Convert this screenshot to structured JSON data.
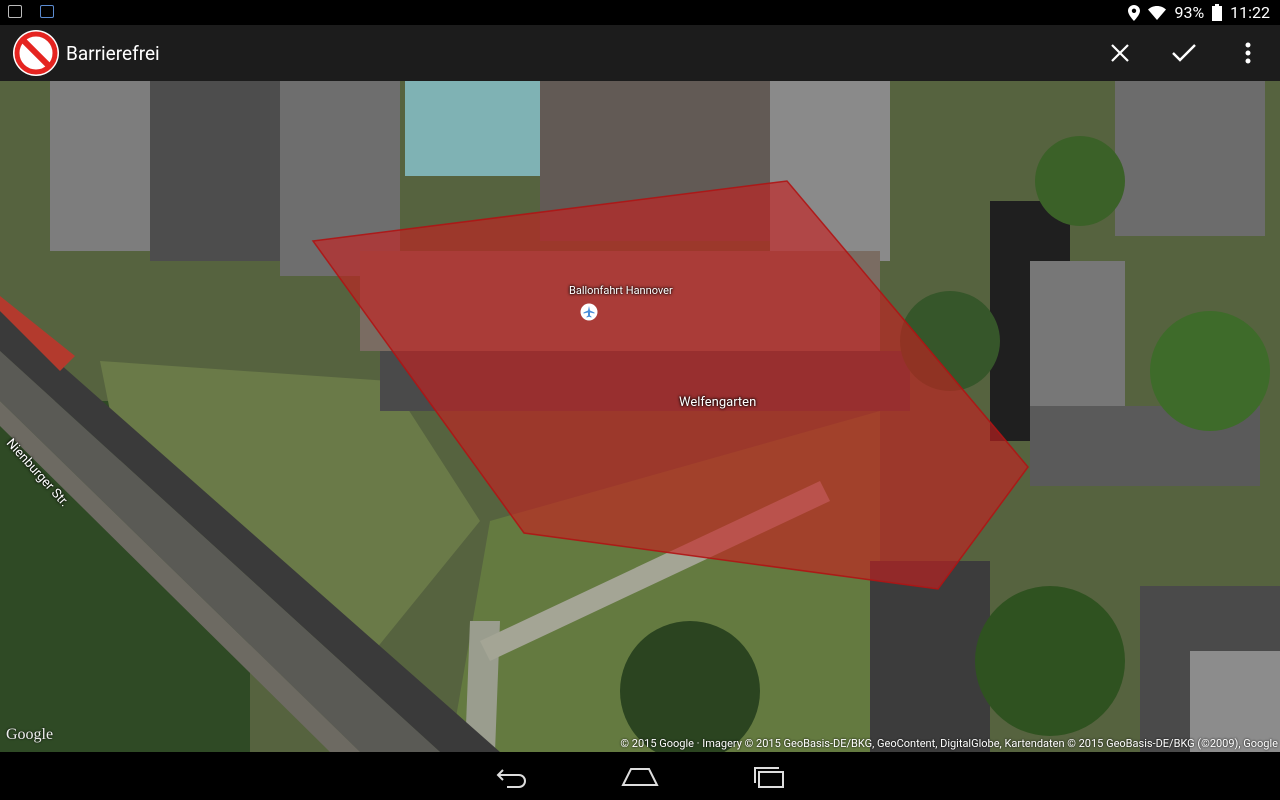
{
  "status_bar": {
    "battery": "93%",
    "time": "11:22",
    "icons": [
      "notification-screenshot-icon",
      "notification-app-icon",
      "location-icon",
      "wifi-icon",
      "battery-icon"
    ]
  },
  "action_bar": {
    "title": "Barrierefrei",
    "icon": "no-entry-icon",
    "actions": [
      "close-icon",
      "check-icon",
      "overflow-menu-icon"
    ]
  },
  "map": {
    "poi_label": "Ballonfahrt Hannover",
    "poi_icon": "airplane-icon",
    "street_labels": [
      "Welfengarten",
      "Nienburger Str."
    ],
    "logo": "Google",
    "attribution": "© 2015 Google · Imagery © 2015 GeoBasis-DE/BKG, GeoContent, DigitalGlobe, Kartendaten © 2015 GeoBasis-DE/BKG (©2009), Google",
    "polygon_color": "#c81e1e"
  },
  "nav_bar": {
    "buttons": [
      "back-icon",
      "home-icon",
      "recents-icon"
    ]
  }
}
